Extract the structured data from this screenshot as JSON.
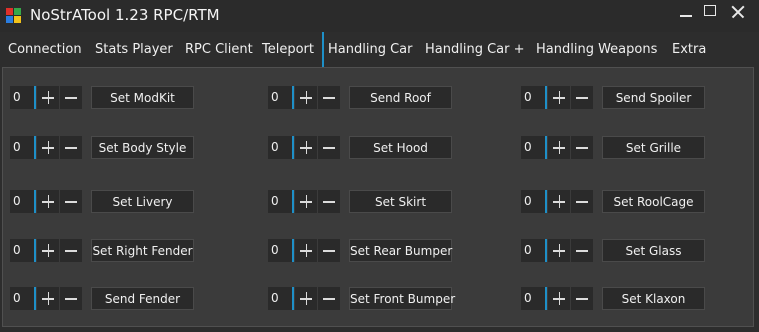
{
  "window": {
    "title": "NoStrATool 1.23 RPC/RTM"
  },
  "tabs": [
    "Connection",
    "Stats Player",
    "RPC Client",
    "Teleport",
    "Handling Car",
    "Handling Car +",
    "Handling Weapons",
    "Extra"
  ],
  "active_tab": "Handling Car",
  "controls": [
    {
      "value": "0",
      "label": "Set ModKit"
    },
    {
      "value": "0",
      "label": "Send Roof"
    },
    {
      "value": "0",
      "label": "Send Spoiler"
    },
    {
      "value": "0",
      "label": "Set Body Style"
    },
    {
      "value": "0",
      "label": "Set Hood"
    },
    {
      "value": "0",
      "label": "Set Grille"
    },
    {
      "value": "0",
      "label": "Set Livery"
    },
    {
      "value": "0",
      "label": "Set Skirt"
    },
    {
      "value": "0",
      "label": "Set RoolCage"
    },
    {
      "value": "0",
      "label": "Set Right Fender"
    },
    {
      "value": "0",
      "label": "Set Rear Bumper"
    },
    {
      "value": "0",
      "label": "Set Glass"
    },
    {
      "value": "0",
      "label": "Send Fender"
    },
    {
      "value": "0",
      "label": "Set Front Bumper"
    },
    {
      "value": "0",
      "label": "Set Klaxon"
    }
  ]
}
